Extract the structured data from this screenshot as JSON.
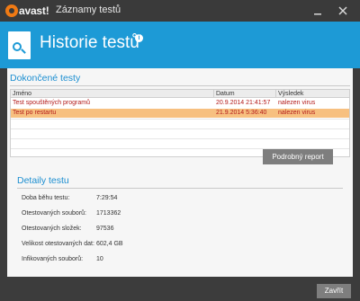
{
  "app": {
    "logo_text": "avast!",
    "window_title": "Záznamy testů"
  },
  "header": {
    "title": "Historie testů",
    "info_glyph": "i",
    "icon": "document-search-icon"
  },
  "completed": {
    "title": "Dokončené testy",
    "columns": [
      "Jméno",
      "Datum",
      "Výsledek"
    ],
    "rows": [
      {
        "name": "Test spouštěných programů",
        "date": "20.9.2014 21:41:57",
        "result": "nalezen virus",
        "selected": false
      },
      {
        "name": "Test po restartu",
        "date": "21.9.2014 5:36:40",
        "result": "nalezen virus",
        "selected": true
      }
    ],
    "report_button": "Podrobný report"
  },
  "details": {
    "title": "Detaily testu",
    "items": [
      {
        "label": "Doba běhu testu:",
        "value": "7:29:54"
      },
      {
        "label": "Otestovaných souborů:",
        "value": "1713362"
      },
      {
        "label": "Otestovaných složek:",
        "value": "97536"
      },
      {
        "label": "Velikost otestovaných dat:",
        "value": "602,4 GB"
      },
      {
        "label": "Infikovaných souborů:",
        "value": "10"
      }
    ]
  },
  "footer": {
    "close_button": "Zavřít"
  },
  "colors": {
    "accent": "#1d9ad6",
    "section_title": "#1d8fd1",
    "virus_text": "#b31a1a",
    "selected_row": "#f7c080",
    "button_gray": "#7e7e7e",
    "chrome": "#3c3c3c"
  }
}
